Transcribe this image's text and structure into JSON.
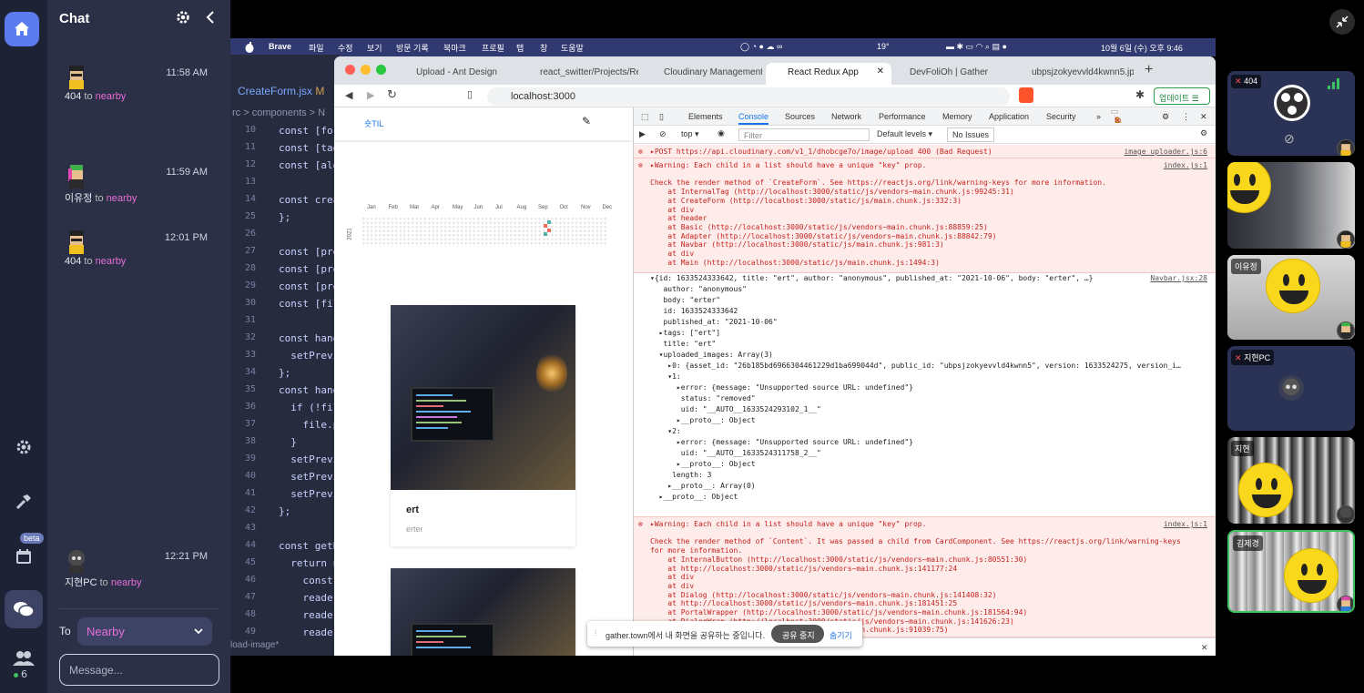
{
  "sidebar": {
    "online_count": "6",
    "beta_badge": "beta"
  },
  "chat": {
    "title": "Chat",
    "messages": [
      {
        "time": "11:58 AM",
        "sender": "404",
        "to": "to",
        "target": "nearby"
      },
      {
        "time": "11:59 AM",
        "sender": "이유정",
        "to": "to",
        "target": "nearby"
      },
      {
        "time": "12:01 PM",
        "sender": "404",
        "to": "to",
        "target": "nearby"
      },
      {
        "time": "12:21 PM",
        "sender": "지현PC",
        "to": "to",
        "target": "nearby"
      }
    ],
    "to_label": "To",
    "recipient": "Nearby",
    "input_placeholder": "Message..."
  },
  "mac_menu": {
    "app": "Brave",
    "items": [
      "파일",
      "수정",
      "보기",
      "방문 기록",
      "북마크",
      "프로필",
      "탭",
      "창",
      "도움말"
    ],
    "temperature": "19°",
    "clock": "10월 6일 (수) 오후 9:46"
  },
  "editor": {
    "filename": "CreateForm.jsx",
    "file_marker": "M",
    "breadcrumb": "rc > components > N",
    "lines": [
      {
        "n": "10",
        "code": "const [for"
      },
      {
        "n": "11",
        "code": "const [tag"
      },
      {
        "n": "12",
        "code": "const [ale"
      },
      {
        "n": "13",
        "code": ""
      },
      {
        "n": "14",
        "code": "const crea"
      },
      {
        "n": "25",
        "code": "};"
      },
      {
        "n": "26",
        "code": ""
      },
      {
        "n": "27",
        "code": "const [pre"
      },
      {
        "n": "28",
        "code": "const [pre"
      },
      {
        "n": "29",
        "code": "const [pre"
      },
      {
        "n": "30",
        "code": "const [fil"
      },
      {
        "n": "31",
        "code": ""
      },
      {
        "n": "32",
        "code": "const hand"
      },
      {
        "n": "33",
        "code": "  setPrevi"
      },
      {
        "n": "34",
        "code": "};"
      },
      {
        "n": "35",
        "code": "const hand"
      },
      {
        "n": "36",
        "code": "  if (!fil"
      },
      {
        "n": "37",
        "code": "    file.p"
      },
      {
        "n": "38",
        "code": "  }"
      },
      {
        "n": "39",
        "code": "  setPrevi"
      },
      {
        "n": "40",
        "code": "  setPrevi"
      },
      {
        "n": "41",
        "code": "  setPrevi"
      },
      {
        "n": "42",
        "code": "};"
      },
      {
        "n": "43",
        "code": ""
      },
      {
        "n": "44",
        "code": "const getB"
      },
      {
        "n": "45",
        "code": "  return n"
      },
      {
        "n": "46",
        "code": "    const"
      },
      {
        "n": "47",
        "code": "    reader"
      },
      {
        "n": "48",
        "code": "    reader"
      },
      {
        "n": "49",
        "code": "    reader"
      }
    ],
    "status": "load-image*"
  },
  "browser": {
    "tabs": [
      "Upload - Ant Design",
      "react_switter/Projects/Re",
      "Cloudinary Management C",
      "React Redux App",
      "DevFoliOh | Gather",
      "ubpsjzokyevvld4kwnn5.jp"
    ],
    "url": "localhost:3000",
    "update_button": "업데이트"
  },
  "app_page": {
    "brand": "숏TIL",
    "months": [
      "Jan",
      "Feb",
      "Mar",
      "Apr",
      "May",
      "Jun",
      "Jul",
      "Aug",
      "Sep",
      "Oct",
      "Nov",
      "Dec"
    ],
    "year": "2021",
    "card": {
      "title": "ert",
      "body": "erter"
    }
  },
  "devtools": {
    "tabs": [
      "Elements",
      "Console",
      "Sources",
      "Network",
      "Performance",
      "Memory",
      "Application",
      "Security"
    ],
    "active_tab": "Console",
    "error_count": "5",
    "warning_count": "1",
    "context": "top",
    "filter_placeholder": "Filter",
    "levels": "Default levels ▾",
    "issues": "No Issues",
    "post_line": "▸POST https://api.cloudinary.com/v1_1/dhobcge7o/image/upload 400 (Bad Request)",
    "post_src": "image_uploader.js:6",
    "warning1": "▸Warning: Each child in a list should have a unique \"key\" prop.\n\nCheck the render method of `CreateForm`. See https://reactjs.org/link/warning-keys for more information.\n    at InternalTag (http://localhost:3000/static/js/vendors~main.chunk.js:99245:31)\n    at CreateForm (http://localhost:3000/static/js/main.chunk.js:332:3)\n    at div\n    at header\n    at Basic (http://localhost:3000/static/js/vendors~main.chunk.js:88859:25)\n    at Adapter (http://localhost:3000/static/js/vendors~main.chunk.js:88842:79)\n    at Navbar (http://localhost:3000/static/js/main.chunk.js:981:3)\n    at div\n    at Main (http://localhost:3000/static/js/main.chunk.js:1494:3)",
    "warning1_src": "index.js:1",
    "obj_src": "Navbar.jsx:28",
    "obj_lines": [
      "▾{id: 1633524333642, title: \"ert\", author: \"anonymous\", published_at: \"2021-10-06\", body: \"erter\", …}",
      "   author: \"anonymous\"",
      "   body: \"erter\"",
      "   id: 1633524333642",
      "   published_at: \"2021-10-06\"",
      "  ▸tags: [\"ert\"]",
      "   title: \"ert\"",
      "  ▾uploaded_images: Array(3)",
      "    ▸0: {asset_id: \"26b185bd6966304461229d1ba699044d\", public_id: \"ubpsjzokyevvld4kwnn5\", version: 1633524275, version_i…",
      "    ▾1:",
      "      ▸error: {message: \"Unsupported source URL: undefined\"}",
      "       status: \"removed\"",
      "       uid: \"__AUTO__1633524293102_1__\"",
      "      ▸__proto__: Object",
      "    ▾2:",
      "      ▸error: {message: \"Unsupported source URL: undefined\"}",
      "       uid: \"__AUTO__1633524311758_2__\"",
      "      ▸__proto__: Object",
      "     length: 3",
      "    ▸__proto__: Array(0)",
      "  ▸__proto__: Object"
    ],
    "warning2": "▸Warning: Each child in a list should have a unique \"key\" prop.\n\nCheck the render method of `Content`. It was passed a child from CardComponent. See https://reactjs.org/link/warning-keys\nfor more information.\n    at InternalButton (http://localhost:3000/static/js/vendors~main.chunk.js:80551:30)\n    at http://localhost:3000/static/js/vendors~main.chunk.js:141177:24\n    at div\n    at div\n    at Dialog (http://localhost:3000/static/js/vendors~main.chunk.js:141408:32)\n    at http://localhost:3000/static/js/vendors~main.chunk.js:181451:25\n    at PortalWrapper (http://localhost:3000/static/js/vendors~main.chunk.js:181564:94)\n    at DialogWrap (http://localhost:3000/static/js/vendors~main.chunk.js:141626:23)\n                                     vendors~main.chunk.js:91039:75)",
    "warning2_src": "index.js:1"
  },
  "share_bar": {
    "text": "gather.town에서 내 화면을 공유하는 중입니다.",
    "stop": "공유 중지",
    "hide": "숨기기"
  },
  "video_tiles": [
    {
      "name": "404"
    },
    {
      "name": ""
    },
    {
      "name": "이유정"
    },
    {
      "name": "지현PC"
    },
    {
      "name": "지현"
    },
    {
      "name": "김제경"
    }
  ],
  "colors": {
    "rail_bg": "#1e2235",
    "chat_bg": "#2b3047",
    "accent": "#5a7cf0",
    "nearby_pink": "#e76ed8",
    "error_red": "#c5221f"
  }
}
